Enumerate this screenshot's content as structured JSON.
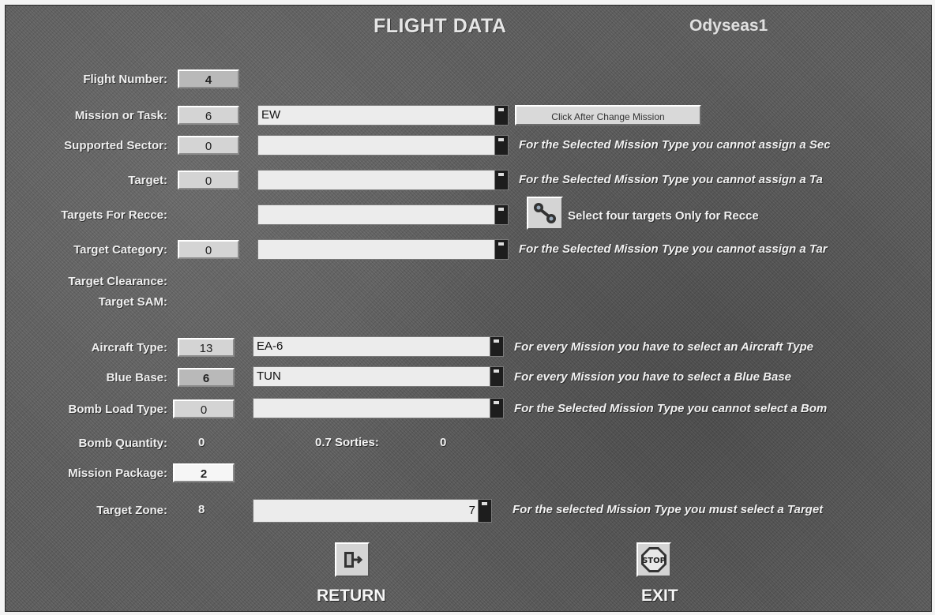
{
  "header": {
    "title": "FLIGHT DATA",
    "user": "Odyseas1"
  },
  "flight_number": {
    "label": "Flight Number:",
    "value": "4"
  },
  "mission": {
    "label": "Mission or Task:",
    "code": "6",
    "selected": "EW",
    "button": "Click After Change Mission"
  },
  "sector": {
    "label": "Supported Sector:",
    "code": "0",
    "selected": "",
    "note": "For the Selected Mission Type you cannot assign a Sec"
  },
  "target": {
    "label": "Target:",
    "code": "0",
    "selected": "",
    "note": "For the Selected Mission Type you cannot assign a Ta"
  },
  "recce": {
    "label": "Targets For Recce:",
    "selected": "",
    "note": "Select four targets Only for Recce"
  },
  "target_category": {
    "label": "Target Category:",
    "code": "0",
    "selected": "",
    "note": "For the Selected Mission Type you cannot assign a Tar"
  },
  "target_clearance": {
    "label": "Target Clearance:"
  },
  "target_sam": {
    "label": "Target SAM:"
  },
  "aircraft": {
    "label": "Aircraft Type:",
    "code": "13",
    "selected": "EA-6",
    "note": "For every Mission you have to select an Aircraft Type"
  },
  "blue_base": {
    "label": "Blue Base:",
    "code": "6",
    "selected": "TUN",
    "note": "For every Mission you have to select a Blue Base"
  },
  "bomb_load": {
    "label": "Bomb Load Type:",
    "code": "0",
    "selected": "",
    "note": "For the Selected Mission Type you cannot select a Bom"
  },
  "bomb_quantity": {
    "label": "Bomb Quantity:",
    "value": "0"
  },
  "sorties": {
    "label": "0.7 Sorties:",
    "value": "0"
  },
  "mission_package": {
    "label": "Mission Package:",
    "value": "2"
  },
  "target_zone": {
    "label": "Target Zone:",
    "value": "8",
    "selected": "7",
    "note": "For the selected Mission Type you must select a Target"
  },
  "actions": {
    "return_label": "RETURN",
    "exit_label": "EXIT",
    "stop_text": "STOP"
  },
  "colors": {
    "panel": "#5c5c5c",
    "field": "#d4d4d4",
    "combo": "#ececec"
  }
}
